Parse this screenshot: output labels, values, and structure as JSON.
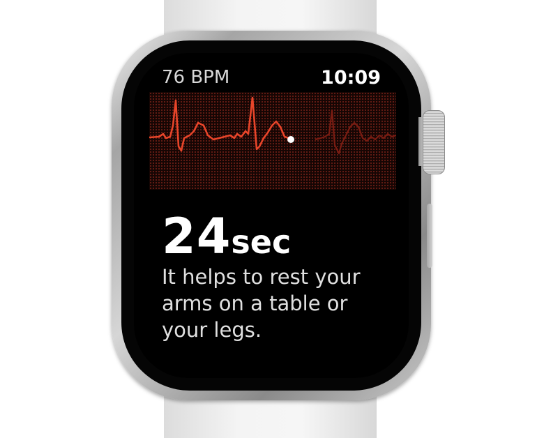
{
  "watch": {
    "heart_rate": "76 BPM",
    "time": "10:09",
    "countdown_value": "24",
    "countdown_unit": "sec",
    "instruction": "It helps to rest your arms on a table or your legs."
  },
  "colors": {
    "ecg_trace": "#e8452a",
    "ecg_trace_faded": "#7a1c12",
    "screen_background": "#000000",
    "text_primary": "#ffffff",
    "text_secondary": "#e0e0e0"
  },
  "icons": [
    "digital-crown",
    "side-button"
  ]
}
